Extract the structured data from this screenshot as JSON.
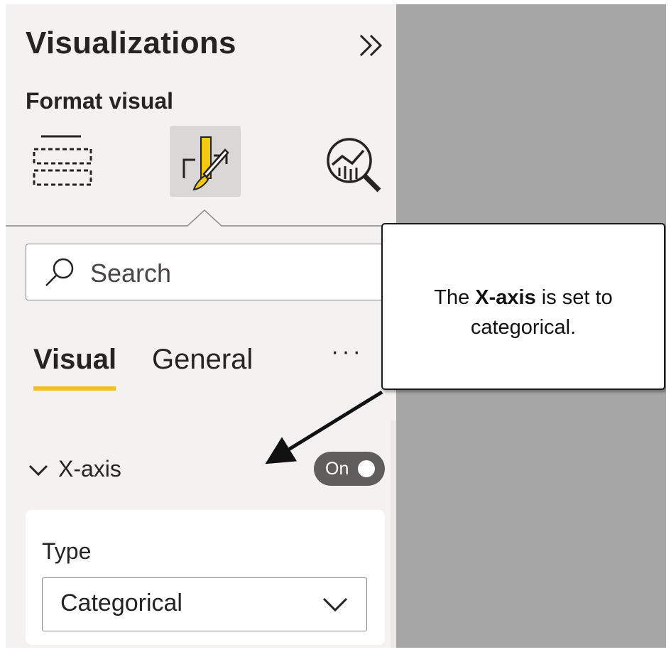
{
  "pane": {
    "title": "Visualizations",
    "subtitle": "Format visual",
    "icons": {
      "collapse": "double-chevron-right-icon",
      "build": "build-visual-icon",
      "format": "format-visual-icon",
      "analytics": "analytics-icon"
    }
  },
  "search": {
    "placeholder": "Search"
  },
  "tabs": [
    {
      "label": "Visual",
      "active": true
    },
    {
      "label": "General",
      "active": false
    }
  ],
  "more_label": "···",
  "section": {
    "label": "X-axis",
    "expanded": true,
    "toggle_label": "On",
    "toggle_on": true
  },
  "card": {
    "type_label": "Type",
    "type_value": "Categorical"
  },
  "callout": {
    "text_before": "The ",
    "text_bold": "X-axis",
    "text_after": " is set to categorical."
  },
  "colors": {
    "accent": "#e8c41f",
    "pane_background": "#f3f2f1",
    "canvas_background": "#a6a6a6",
    "toggle_background": "#605e5c"
  }
}
